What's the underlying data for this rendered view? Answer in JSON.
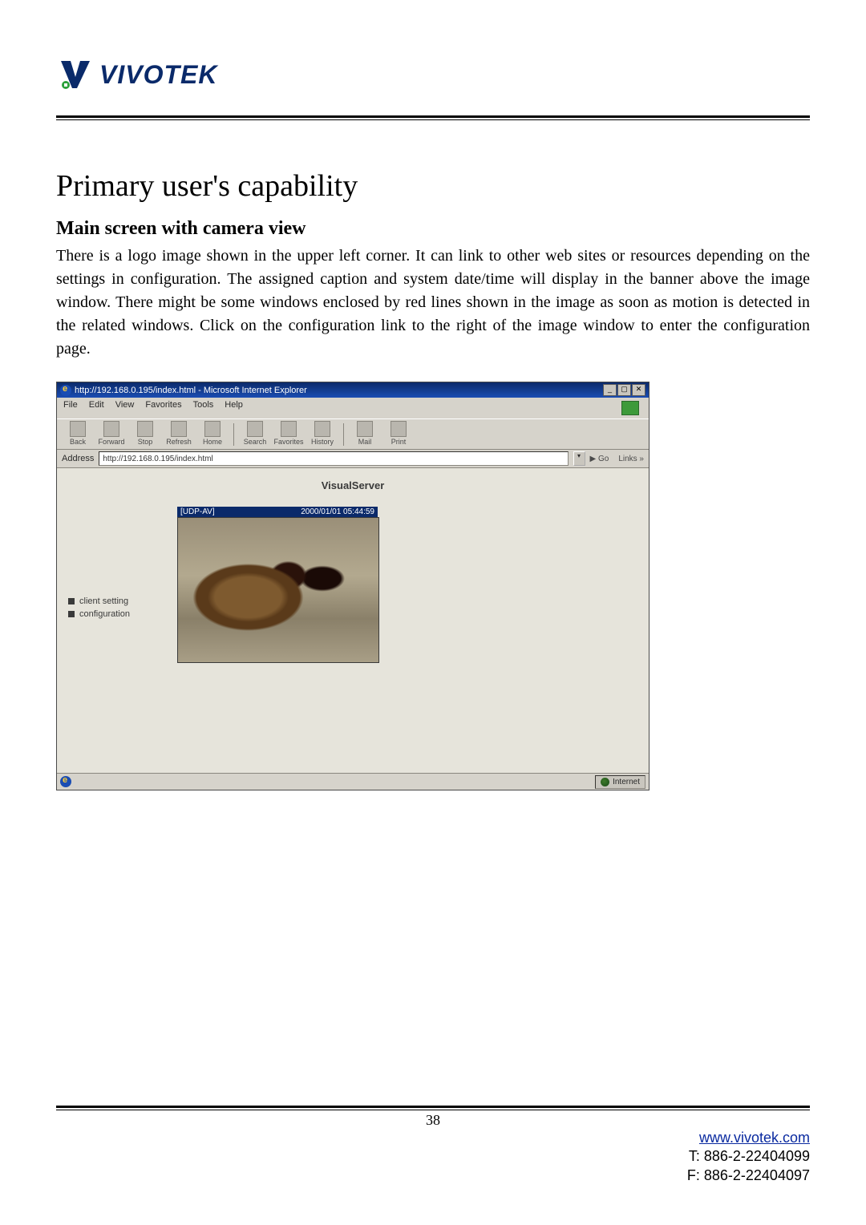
{
  "header": {
    "logo_text": "VIVOTEK"
  },
  "content": {
    "title": "Primary user's capability",
    "subtitle": "Main screen with camera view",
    "paragraph": "There is a logo image shown in the upper left corner. It can link to other web sites or resources depending on the settings in configuration. The assigned caption and system date/time will display in the banner above the image window. There might be some windows enclosed by red lines shown in the image as soon as motion is detected in the related windows. Click on the configuration link to the right of the image window to enter the configuration page."
  },
  "screenshot": {
    "title": "http://192.168.0.195/index.html - Microsoft Internet Explorer",
    "menu": {
      "file": "File",
      "edit": "Edit",
      "view": "View",
      "favorites": "Favorites",
      "tools": "Tools",
      "help": "Help"
    },
    "toolbar": {
      "back": "Back",
      "forward": "Forward",
      "stop": "Stop",
      "refresh": "Refresh",
      "home": "Home",
      "search": "Search",
      "favorites": "Favorites",
      "history": "History",
      "mail": "Mail",
      "print": "Print"
    },
    "address_label": "Address",
    "address_value": "http://192.168.0.195/index.html",
    "go_label": "Go",
    "links_label": "Links »",
    "banner": "VisualServer",
    "cam_protocol": "[UDP-AV]",
    "cam_timestamp": "2000/01/01 05:44:59",
    "side_links": {
      "client_setting": "client setting",
      "configuration": "configuration"
    },
    "status_zone": "Internet"
  },
  "footer": {
    "page_number": "38",
    "url": "www.vivotek.com",
    "tel": "T: 886-2-22404099",
    "fax": "F: 886-2-22404097"
  }
}
